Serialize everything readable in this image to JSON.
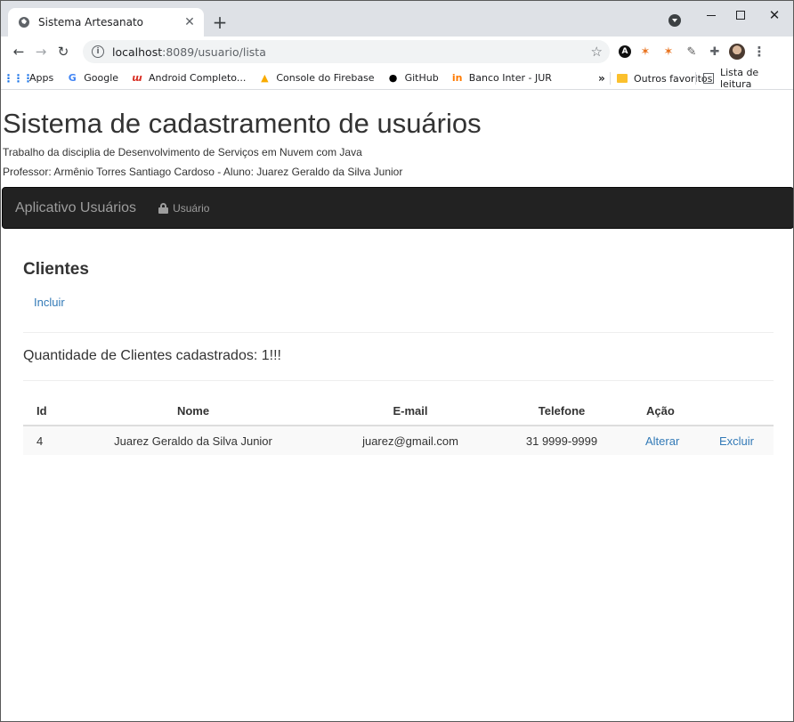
{
  "browser": {
    "tab_title": "Sistema Artesanato",
    "new_tab_label": "+",
    "url_host": "localhost",
    "url_rest": ":8089/usuario/lista",
    "bookmarks": [
      {
        "label": "Apps",
        "icon": "apps-grid-icon"
      },
      {
        "label": "Google",
        "icon": "google-icon"
      },
      {
        "label": "Android Completo...",
        "icon": "android-completo-icon"
      },
      {
        "label": "Console do Firebase",
        "icon": "firebase-icon"
      },
      {
        "label": "GitHub",
        "icon": "github-icon"
      },
      {
        "label": "Banco Inter - JUR",
        "icon": "inter-icon"
      }
    ],
    "bookmarks_more": "»",
    "other_bookmarks": "Outros favoritos",
    "reading_list": "Lista de leitura"
  },
  "page": {
    "title": "Sistema de cadastramento de usuários",
    "subtitle_1": "Trabalho da disciplia de Desenvolvimento de Serviços em Nuvem com Java",
    "subtitle_2": "Professor: Armênio Torres Santiago Cardoso - Aluno: Juarez Geraldo da Silva Junior",
    "navbar": {
      "brand": "Aplicativo Usuários",
      "link_usuario": "Usuário"
    },
    "section_title": "Clientes",
    "incluir_label": "Incluir",
    "count_text": "Quantidade de Clientes cadastrados: 1!!!",
    "table": {
      "headers": {
        "id": "Id",
        "nome": "Nome",
        "email": "E-mail",
        "telefone": "Telefone",
        "acao": "Ação"
      },
      "rows": [
        {
          "id": "4",
          "nome": "Juarez Geraldo da Silva Junior",
          "email": "juarez@gmail.com",
          "telefone": "31 9999-9999",
          "alterar": "Alterar",
          "excluir": "Excluir"
        }
      ]
    }
  },
  "colors": {
    "link": "#337ab7",
    "navbar_bg": "#222222",
    "navbar_text": "#9d9d9d",
    "row_stripe": "#f9f9f9"
  }
}
